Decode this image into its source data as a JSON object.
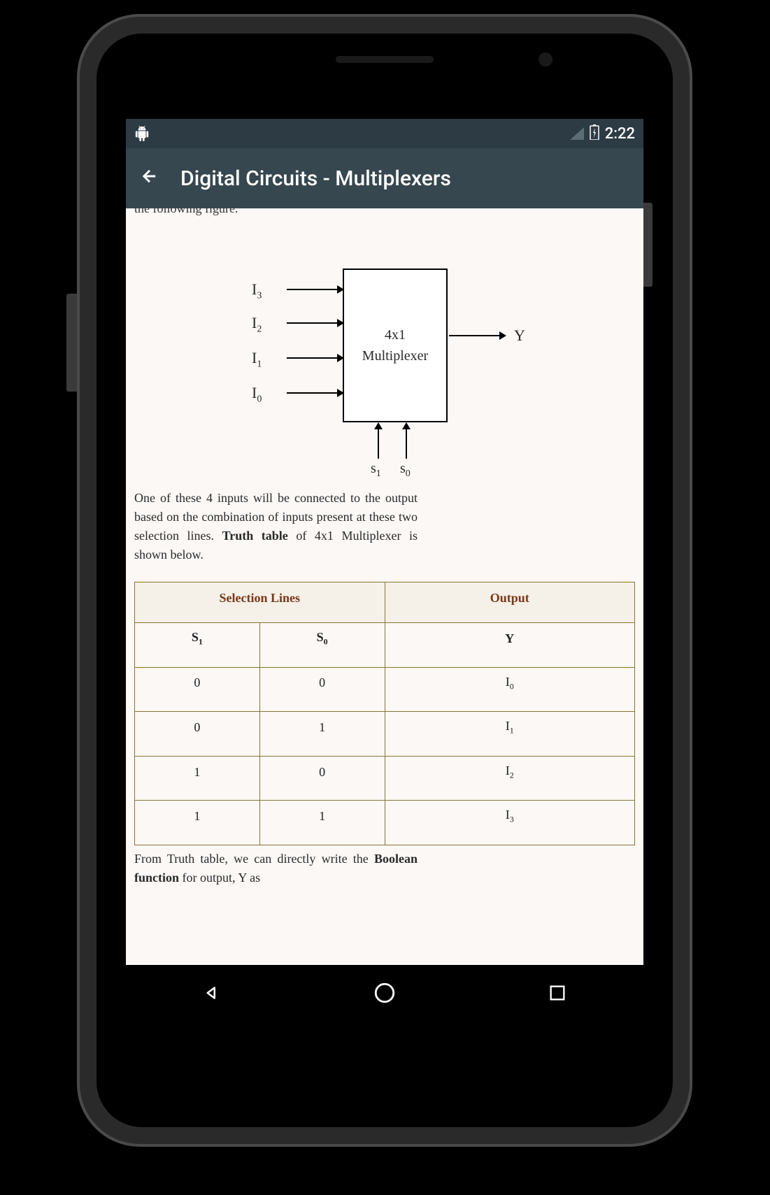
{
  "statusBar": {
    "time": "2:22"
  },
  "appBar": {
    "title": "Digital Circuits - Multiplexers"
  },
  "content": {
    "truncatedTop": "the following figure.",
    "diagram": {
      "inputs": [
        "I₃",
        "I₂",
        "I₁",
        "I₀"
      ],
      "selects": [
        "s₁",
        "s₀"
      ],
      "output": "Y",
      "boxLine1": "4x1",
      "boxLine2": "Multiplexer"
    },
    "paragraph1_pre": "One of these 4 inputs will be connected to the output based on the combination of inputs present at these two selection lines. ",
    "paragraph1_bold": "Truth table",
    "paragraph1_post": " of 4x1 Multiplexer is shown below.",
    "table": {
      "header1": "Selection Lines",
      "header2": "Output",
      "colS1": "S",
      "colS1_sub": "1",
      "colS0": "S",
      "colS0_sub": "0",
      "colY": "Y",
      "rows": [
        {
          "s1": "0",
          "s0": "0",
          "y": "I",
          "ysub": "0"
        },
        {
          "s1": "0",
          "s0": "1",
          "y": "I",
          "ysub": "1"
        },
        {
          "s1": "1",
          "s0": "0",
          "y": "I",
          "ysub": "2"
        },
        {
          "s1": "1",
          "s0": "1",
          "y": "I",
          "ysub": "3"
        }
      ]
    },
    "paragraph2_pre": "From Truth table, we can directly write the ",
    "paragraph2_bold": "Boolean function",
    "paragraph2_post": " for output, Y as"
  }
}
